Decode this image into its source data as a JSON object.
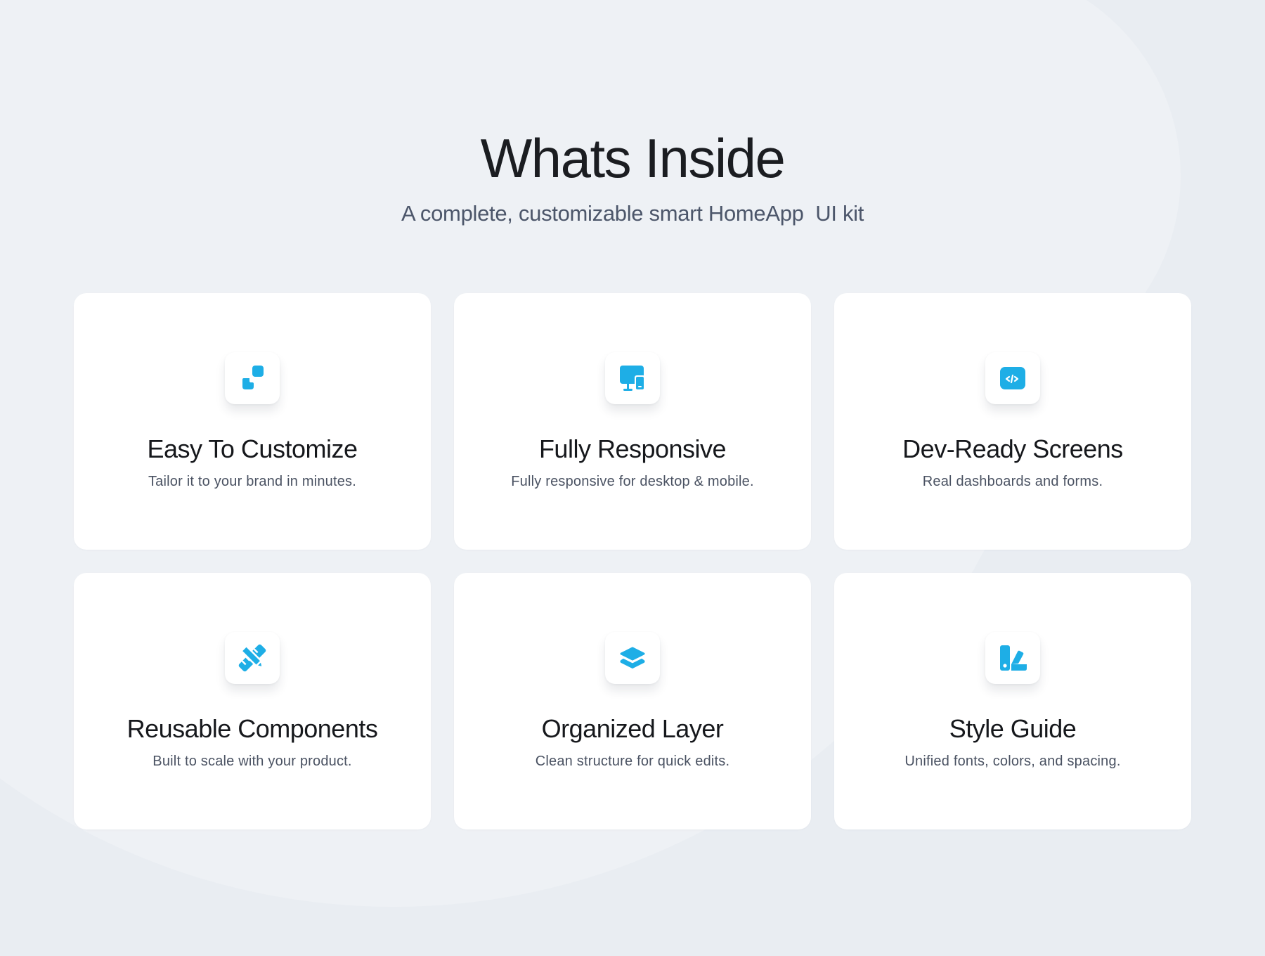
{
  "header": {
    "title": "Whats Inside",
    "subtitle": "A complete, customizable smart HomeApp  UI kit"
  },
  "colors": {
    "background": "#e9edf2",
    "card": "#ffffff",
    "accent": "#1eaee6",
    "title_text": "#1b1d21",
    "subtitle_text": "#4c566a"
  },
  "features": [
    {
      "icon": "customize-squares-icon",
      "title": "Easy To Customize",
      "description": "Tailor it to your brand in minutes."
    },
    {
      "icon": "responsive-devices-icon",
      "title": "Fully Responsive",
      "description": "Fully responsive for desktop & mobile."
    },
    {
      "icon": "code-window-icon",
      "title": "Dev-Ready Screens",
      "description": "Real dashboards and forms."
    },
    {
      "icon": "pencil-ruler-icon",
      "title": "Reusable Components",
      "description": "Built to scale with your product."
    },
    {
      "icon": "layers-icon",
      "title": "Organized Layer",
      "description": "Clean structure for quick edits."
    },
    {
      "icon": "swatch-book-icon",
      "title": "Style Guide",
      "description": "Unified fonts, colors, and spacing."
    }
  ]
}
